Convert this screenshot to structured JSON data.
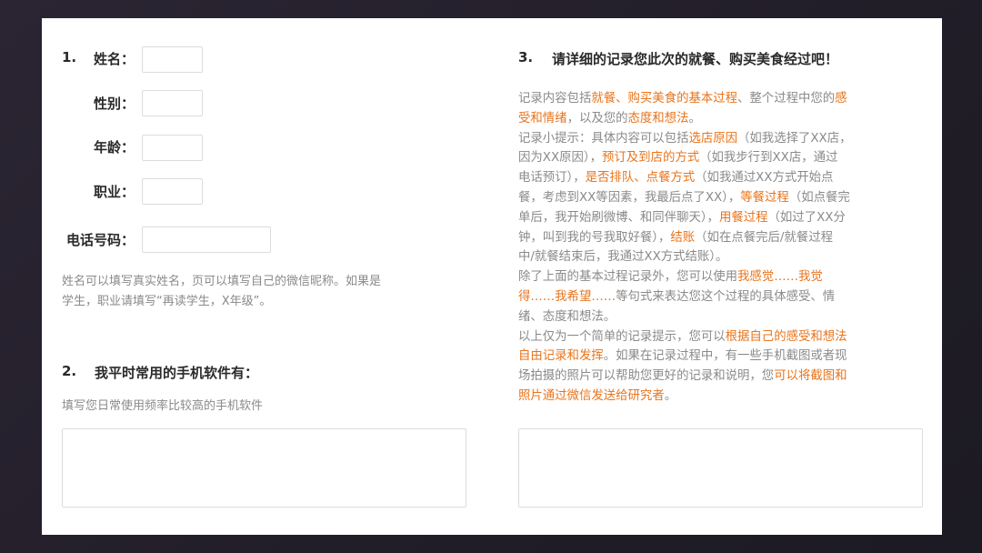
{
  "section1": {
    "number": "1.",
    "fields": [
      {
        "label": "姓名："
      },
      {
        "label": "性别："
      },
      {
        "label": "年龄："
      },
      {
        "label": "职业："
      },
      {
        "label": "电话号码："
      }
    ],
    "hint_line1": "姓名可以填写真实姓名，页可以填写自己的微信昵称。如果是",
    "hint_line2": "学生，职业请填写“再读学生，X年级”。"
  },
  "section2": {
    "number": "2.",
    "title": "我平时常用的手机软件有：",
    "hint": "填写您日常使用频率比较高的手机软件"
  },
  "section3": {
    "number": "3.",
    "title": "请详细的记录您此次的就餐、购买美食经过吧！",
    "lines": [
      [
        {
          "t": "记录内容包括"
        },
        {
          "t": "就餐、购买美食的基本过程",
          "h": true
        },
        {
          "t": "、整个过程中您的"
        },
        {
          "t": "感",
          "h": true
        }
      ],
      [
        {
          "t": "受和情绪",
          "h": true
        },
        {
          "t": "，以及您的"
        },
        {
          "t": "态度和想法",
          "h": true
        },
        {
          "t": "。"
        }
      ],
      [
        {
          "t": "记录小提示：具体内容可以包括"
        },
        {
          "t": "选店原因",
          "h": true
        },
        {
          "t": "（如我选择了XX店，"
        }
      ],
      [
        {
          "t": "因为XX原因），"
        },
        {
          "t": "预订及到店的方式",
          "h": true
        },
        {
          "t": "（如我步行到XX店，通过"
        }
      ],
      [
        {
          "t": "电话预订），"
        },
        {
          "t": "是否排队、点餐方式",
          "h": true
        },
        {
          "t": "（如我通过XX方式开始点"
        }
      ],
      [
        {
          "t": "餐，考虑到XX等因素，我最后点了XX），"
        },
        {
          "t": "等餐过程",
          "h": true
        },
        {
          "t": "（如点餐完"
        }
      ],
      [
        {
          "t": "单后，我开始刷微博、和同伴聊天），"
        },
        {
          "t": "用餐过程",
          "h": true
        },
        {
          "t": "（如过了XX分"
        }
      ],
      [
        {
          "t": "钟，叫到我的号我取好餐），"
        },
        {
          "t": "结账",
          "h": true
        },
        {
          "t": "（如在点餐完后/就餐过程"
        }
      ],
      [
        {
          "t": "中/就餐结束后，我通过XX方式结账）。"
        }
      ],
      [
        {
          "t": "除了上面的基本过程记录外，您可以使用"
        },
        {
          "t": "我感觉……我觉",
          "h": true
        }
      ],
      [
        {
          "t": "得……我希望……",
          "h": true
        },
        {
          "t": "等句式来表达您这个过程的具体感受、情"
        }
      ],
      [
        {
          "t": "绪、态度和想法。"
        }
      ],
      [
        {
          "t": "以上仅为一个简单的记录提示，您可以"
        },
        {
          "t": "根据自己的感受和想法",
          "h": true
        }
      ],
      [
        {
          "t": "自由记录和发挥",
          "h": true
        },
        {
          "t": "。如果在记录过程中，有一些手机截图或者现"
        }
      ],
      [
        {
          "t": "场拍摄的照片可以帮助您更好的记录和说明，您"
        },
        {
          "t": "可以将截图和",
          "h": true
        }
      ],
      [
        {
          "t": "照片通过微信发送给研究者",
          "h": true
        },
        {
          "t": "。"
        }
      ]
    ]
  },
  "colors": {
    "highlight": "#e8741c",
    "text": "#2a2a2a",
    "hint": "#8a8a8a",
    "background": "#252129"
  }
}
